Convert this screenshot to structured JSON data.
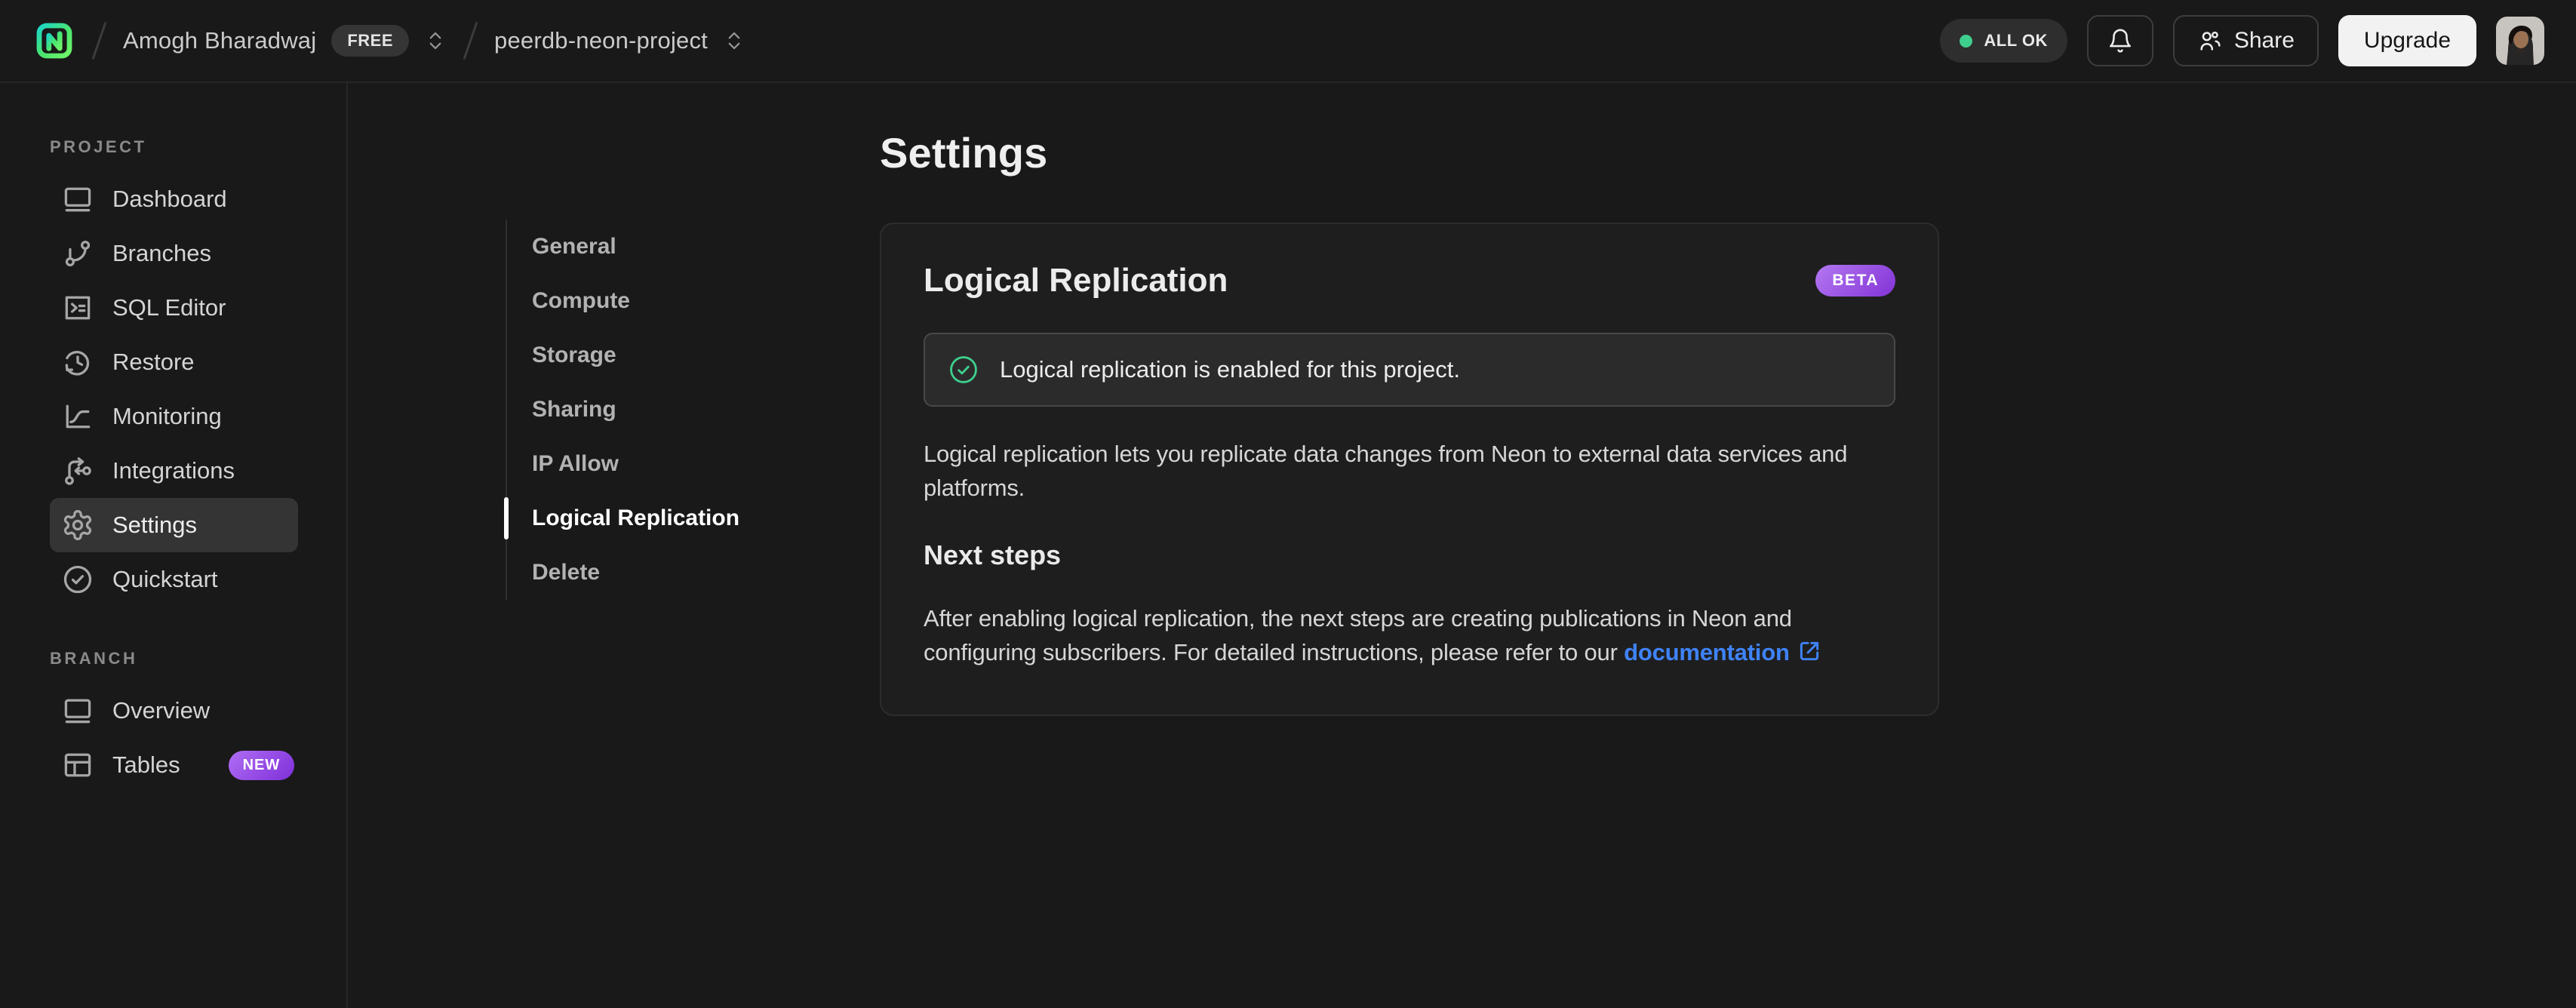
{
  "topbar": {
    "org_name": "Amogh Bharadwaj",
    "org_plan_badge": "FREE",
    "project_name": "peerdb-neon-project",
    "status_pill": "ALL OK",
    "share_label": "Share",
    "upgrade_label": "Upgrade",
    "icons": [
      "neon-logo-icon",
      "chevrons-up-down-icon",
      "bell-icon",
      "users-icon",
      "avatar"
    ]
  },
  "colors": {
    "background": "#191919",
    "accent_green": "#3ecf8e",
    "link_blue": "#3f83f8",
    "badge_purple": "#8233d6",
    "upgrade_button": "#f2f2f2"
  },
  "sidebar": {
    "project_section": "PROJECT",
    "branch_section": "BRANCH",
    "project_items": [
      {
        "label": "Dashboard",
        "icon": "dashboard-icon",
        "active": false
      },
      {
        "label": "Branches",
        "icon": "git-branch-icon",
        "active": false
      },
      {
        "label": "SQL Editor",
        "icon": "terminal-icon",
        "active": false
      },
      {
        "label": "Restore",
        "icon": "history-icon",
        "active": false
      },
      {
        "label": "Monitoring",
        "icon": "chart-icon",
        "active": false
      },
      {
        "label": "Integrations",
        "icon": "route-icon",
        "active": false
      },
      {
        "label": "Settings",
        "icon": "gear-icon",
        "active": true
      },
      {
        "label": "Quickstart",
        "icon": "check-circle-icon",
        "active": false
      }
    ],
    "branch_items": [
      {
        "label": "Overview",
        "icon": "window-icon",
        "badge": ""
      },
      {
        "label": "Tables",
        "icon": "table-icon",
        "badge": "NEW"
      }
    ]
  },
  "settings_nav": {
    "items": [
      "General",
      "Compute",
      "Storage",
      "Sharing",
      "IP Allow",
      "Logical Replication",
      "Delete"
    ],
    "active": "Logical Replication"
  },
  "main": {
    "page_title": "Settings",
    "card": {
      "title": "Logical Replication",
      "beta_badge": "BETA",
      "banner_text": "Logical replication is enabled for this project.",
      "description": "Logical replication lets you replicate data changes from Neon to external data services and platforms.",
      "next_steps_title": "Next steps",
      "next_steps_text_before": "After enabling logical replication, the next steps are creating publications in Neon and configuring subscribers. For detailed instructions, please refer to our ",
      "doc_link_label": "documentation"
    }
  }
}
